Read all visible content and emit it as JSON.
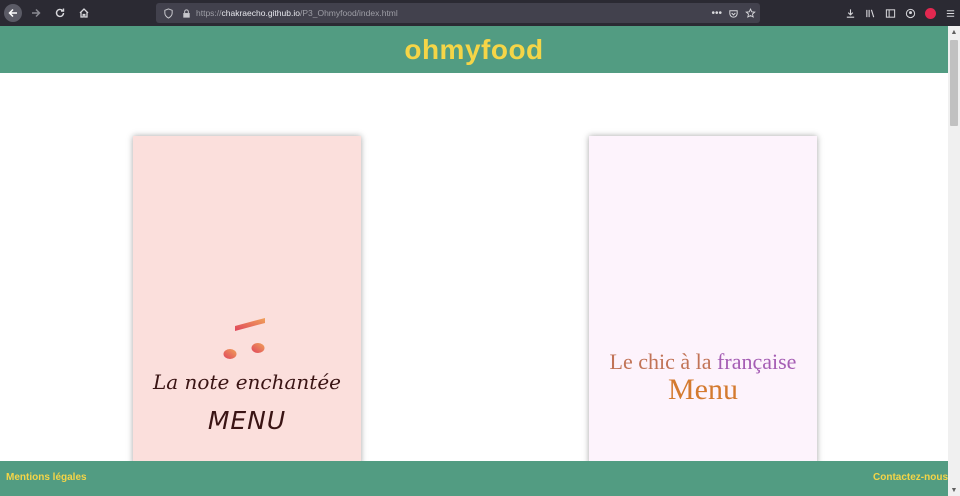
{
  "browser": {
    "url_prefix": "https://",
    "url_domain": "chakraecho.github.io",
    "url_path": "/P3_Ohmyfood/index.html",
    "page_actions_label": "•••"
  },
  "header": {
    "title": "ohmyfood"
  },
  "cards": [
    {
      "title": "La note enchantée",
      "menu_label": "MENU"
    },
    {
      "title_part1": "Le chic à la ",
      "title_part2": "française",
      "menu_label": "Menu"
    }
  ],
  "footer": {
    "left_link": "Mentions légales",
    "right_link": "Contactez-nous"
  },
  "colors": {
    "header_bg": "#529c82",
    "title_yellow": "#f5d547",
    "card1_bg": "#fbdfdc",
    "card2_bg": "#fdf3fc"
  },
  "icons": [
    "back-arrow-icon",
    "forward-arrow-icon",
    "reload-icon",
    "home-icon",
    "shield-icon",
    "lock-icon",
    "pocket-icon",
    "bookmark-star-icon",
    "download-icon",
    "library-icon",
    "sidebar-icon",
    "account-icon",
    "extension-icon",
    "hamburger-menu-icon",
    "music-note-icon"
  ]
}
